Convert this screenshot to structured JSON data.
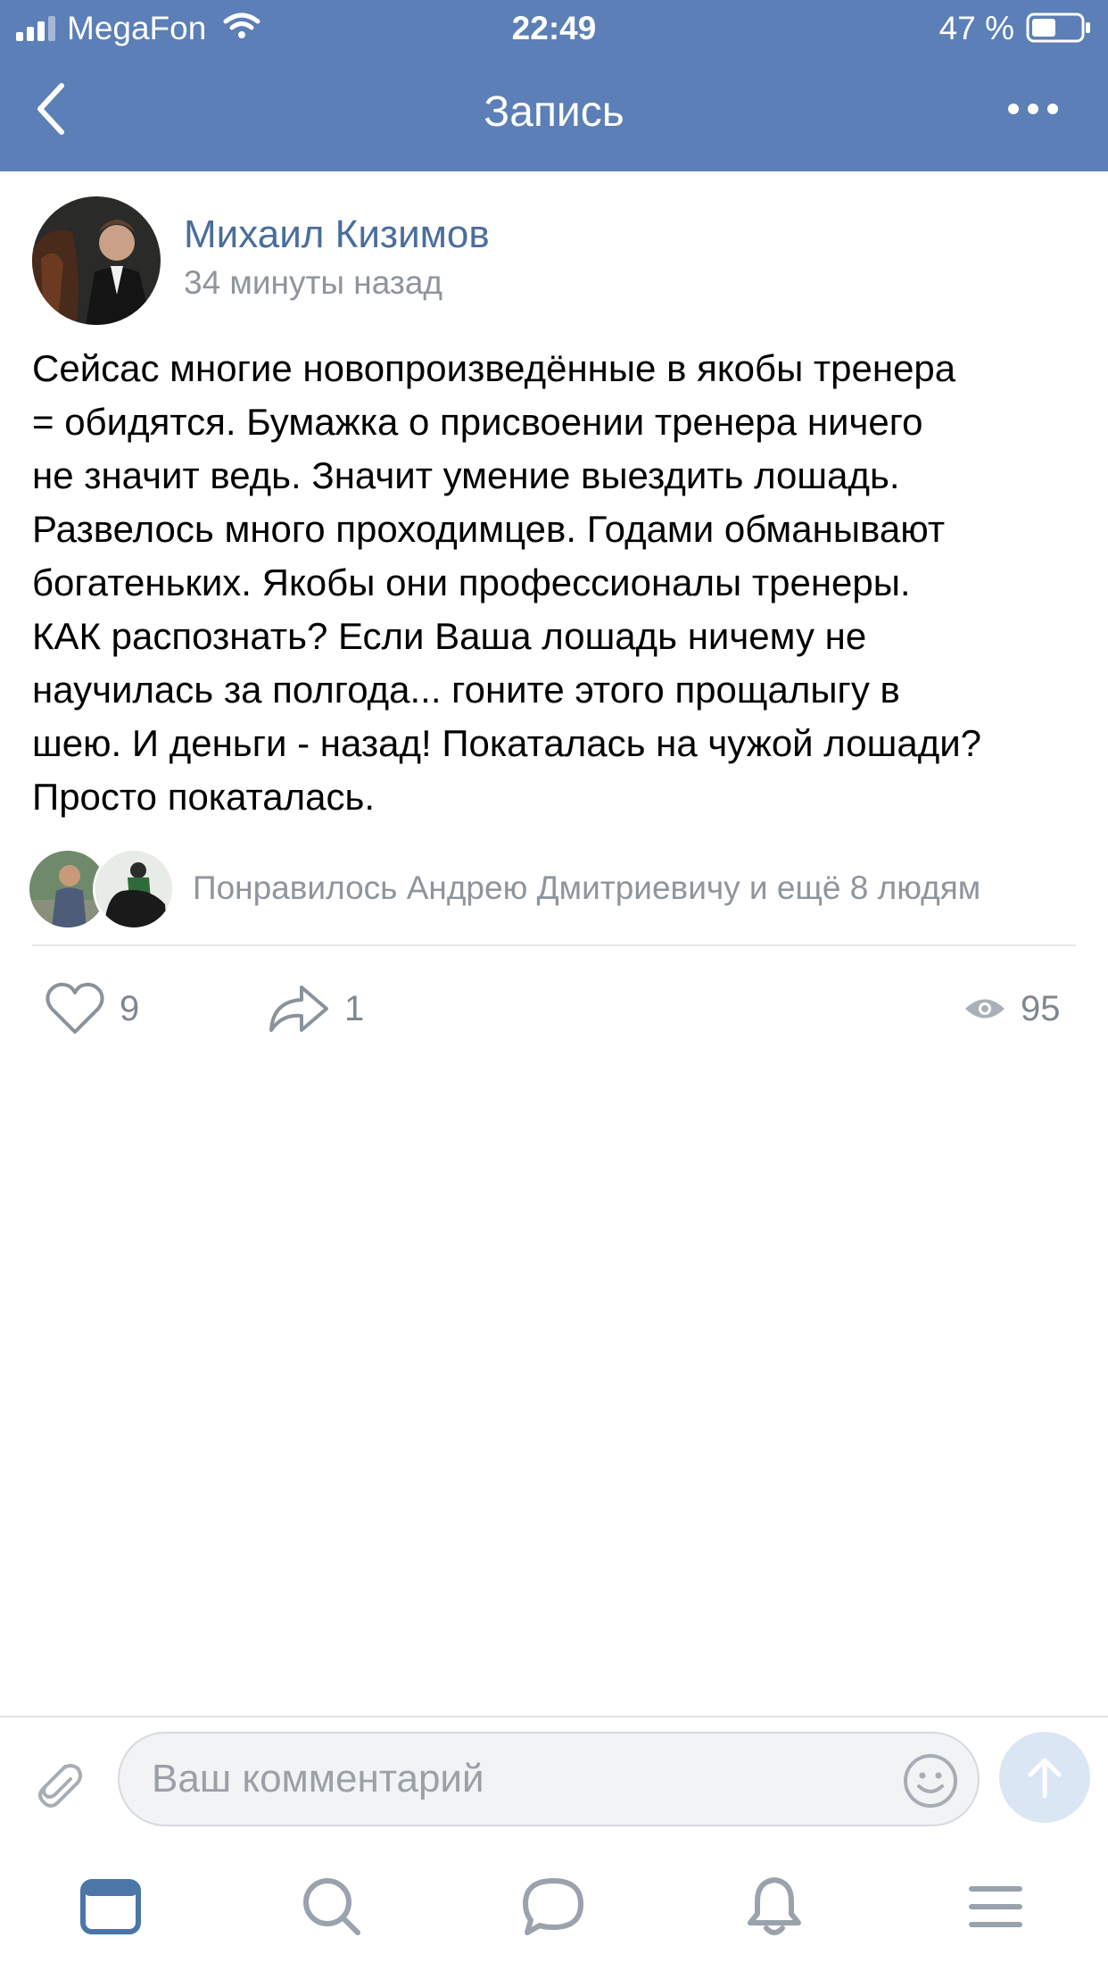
{
  "status_bar": {
    "carrier": "MegaFon",
    "time": "22:49",
    "battery_percent": "47 %"
  },
  "nav": {
    "title": "Запись",
    "back_icon": "chevron-left-icon",
    "more_icon": "more-horizontal-icon"
  },
  "post": {
    "author": "Михаил Кизимов",
    "time": "34 минуты назад",
    "text_lines": [
      "Сейсас многие новопроизведённые в якобы тренера",
      "= обидятся. Бумажка о присвоении тренера ничего",
      "не значит ведь. Значит умение выездить лошадь.",
      "Развелось много проходимцев. Годами обманывают",
      "богатеньких. Якобы они профессионалы тренеры.",
      "КАК распознать? Если Ваша лошадь ничему не",
      "научилась за полгода... гоните этого прощалыгу в",
      "шею. И деньги - назад! Покаталась на чужой лошади?",
      "Просто покаталась."
    ],
    "liked_by": "Понравилось Андрею Дмитриевичу и ещё 8 людям",
    "likes": "9",
    "shares": "1",
    "views": "95"
  },
  "comment": {
    "placeholder": "Ваш комментарий"
  },
  "tabs": [
    {
      "icon": "news-icon",
      "active": true
    },
    {
      "icon": "search-icon",
      "active": false
    },
    {
      "icon": "messages-icon",
      "active": false
    },
    {
      "icon": "notifications-icon",
      "active": false
    },
    {
      "icon": "menu-icon",
      "active": false
    }
  ],
  "colors": {
    "header_bg": "#5b7fb6",
    "accent": "#4a6e9b",
    "secondary_text": "#8e959d",
    "active_tab": "#4a76a8",
    "inactive_tab": "#99a2ad"
  }
}
